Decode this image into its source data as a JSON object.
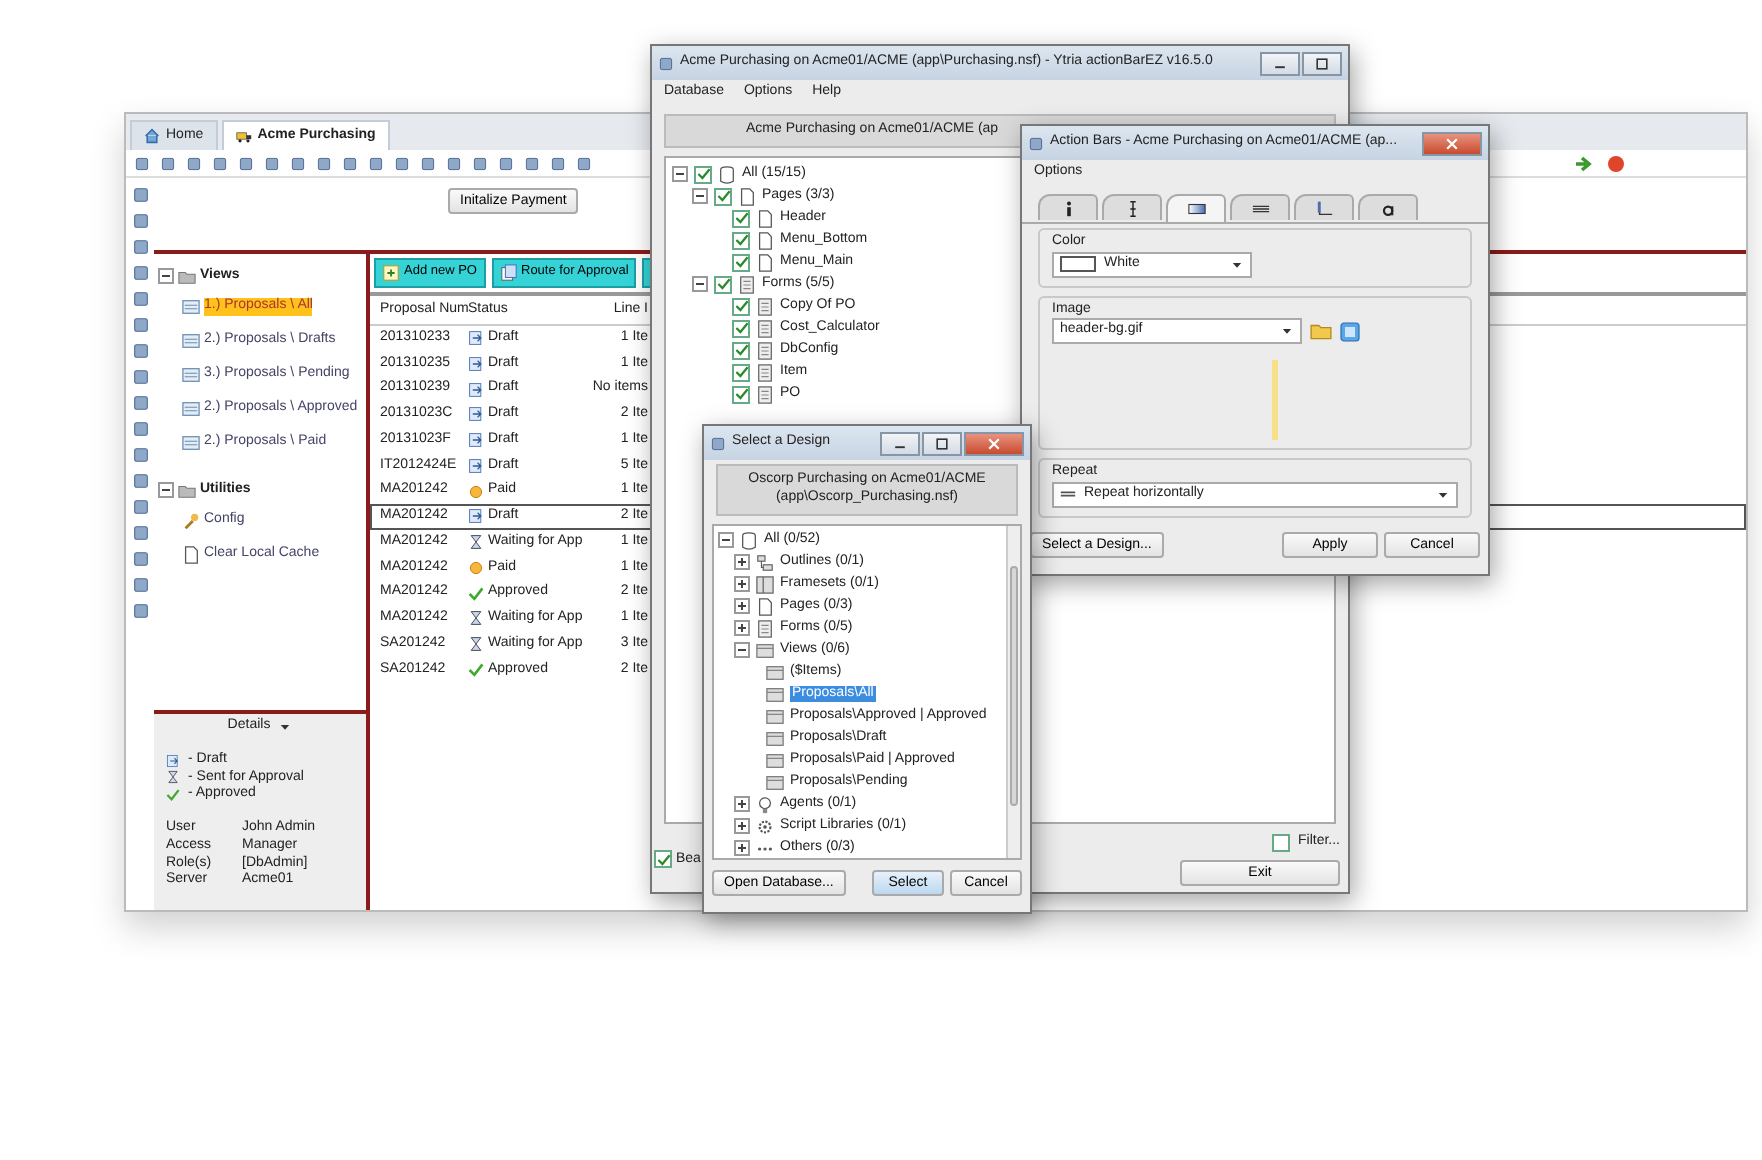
{
  "app": {
    "tabs": [
      {
        "label": "Home",
        "kind": "home",
        "selected": false
      },
      {
        "label": "Acme Purchasing",
        "kind": "truck",
        "selected": true
      }
    ],
    "initialize_button": "Initalize Payment",
    "nav": [
      {
        "label": "Views",
        "kind": "folder",
        "expanded": true,
        "children": [
          {
            "label": "1.) Proposals \\ All",
            "kind": "list",
            "selected": true
          },
          {
            "label": "2.) Proposals \\ Drafts",
            "kind": "list",
            "selected": false
          },
          {
            "label": "3.) Proposals \\ Pending",
            "kind": "list",
            "selected": false
          },
          {
            "label": "2.) Proposals \\ Approved",
            "kind": "list",
            "selected": false
          },
          {
            "label": "2.) Proposals \\ Paid",
            "kind": "list",
            "selected": false
          }
        ]
      },
      {
        "label": "Utilities",
        "kind": "folder",
        "expanded": true,
        "children": [
          {
            "label": "Config",
            "kind": "wrench",
            "selected": false
          },
          {
            "label": "Clear Local Cache",
            "kind": "page",
            "selected": false
          }
        ]
      }
    ],
    "details": {
      "title": "Details",
      "legend": [
        {
          "kind": "draft",
          "label": "- Draft"
        },
        {
          "kind": "waiting",
          "label": "- Sent for Approval"
        },
        {
          "kind": "approved",
          "label": "- Approved"
        }
      ],
      "info": [
        {
          "label": "User",
          "value": "John Admin"
        },
        {
          "label": "Access",
          "value": "Manager"
        },
        {
          "label": "Role(s)",
          "value": "[DbAdmin]"
        },
        {
          "label": "Server",
          "value": "Acme01"
        }
      ]
    },
    "actions": [
      "Add new PO",
      "Route for Approval"
    ],
    "table": {
      "columns": [
        "Proposal Num",
        "Status",
        "Line I"
      ],
      "rows": [
        {
          "number": "201310233",
          "status": "Draft",
          "kind": "draft",
          "items": "1 Ite",
          "selected": false
        },
        {
          "number": "201310235",
          "status": "Draft",
          "kind": "draft",
          "items": "1 Ite",
          "selected": false
        },
        {
          "number": "201310239",
          "status": "Draft",
          "kind": "draft",
          "items": "No items",
          "selected": false
        },
        {
          "number": "20131023C",
          "status": "Draft",
          "kind": "draft",
          "items": "2 Ite",
          "selected": false
        },
        {
          "number": "20131023F",
          "status": "Draft",
          "kind": "draft",
          "items": "1 Ite",
          "selected": false
        },
        {
          "number": "IT2012424E",
          "status": "Draft",
          "kind": "draft",
          "items": "5 Ite",
          "selected": false
        },
        {
          "number": "MA201242",
          "status": "Paid",
          "kind": "paid",
          "items": "1 Ite",
          "selected": false
        },
        {
          "number": "MA201242",
          "status": "Draft",
          "kind": "draft",
          "items": "2 Ite",
          "selected": true
        },
        {
          "number": "MA201242",
          "status": "Waiting for App",
          "kind": "waiting",
          "items": "1 Ite",
          "selected": false
        },
        {
          "number": "MA201242",
          "status": "Paid",
          "kind": "paid",
          "items": "1 Ite",
          "selected": false
        },
        {
          "number": "MA201242",
          "status": "Approved",
          "kind": "approved",
          "items": "2 Ite",
          "selected": false
        },
        {
          "number": "MA201242",
          "status": "Waiting for App",
          "kind": "waiting",
          "items": "1 Ite",
          "selected": false
        },
        {
          "number": "SA201242",
          "status": "Waiting for App",
          "kind": "waiting",
          "items": "3 Ite",
          "selected": false
        },
        {
          "number": "SA201242",
          "status": "Approved",
          "kind": "approved",
          "items": "2 Ite",
          "selected": false
        }
      ]
    }
  },
  "ytria_window": {
    "title": "Acme Purchasing on Acme01/ACME (app\\Purchasing.nsf) - Ytria actionBarEZ v16.5.0",
    "menu": [
      "Database",
      "Options",
      "Help"
    ],
    "header": "Acme Purchasing on Acme01/ACME (ap",
    "tree": [
      {
        "label": "All (15/15)",
        "kind": "db",
        "expanded": true,
        "checked": true,
        "children": [
          {
            "label": "Pages (3/3)",
            "kind": "page",
            "expanded": true,
            "checked": true,
            "children": [
              {
                "label": "Header",
                "kind": "page",
                "checked": true
              },
              {
                "label": "Menu_Bottom",
                "kind": "page",
                "checked": true
              },
              {
                "label": "Menu_Main",
                "kind": "page",
                "checked": true
              }
            ]
          },
          {
            "label": "Forms (5/5)",
            "kind": "form",
            "expanded": true,
            "checked": true,
            "children": [
              {
                "label": "Copy Of PO",
                "kind": "form",
                "checked": true
              },
              {
                "label": "Cost_Calculator",
                "kind": "form",
                "checked": true
              },
              {
                "label": "DbConfig",
                "kind": "form",
                "checked": true
              },
              {
                "label": "Item",
                "kind": "form",
                "checked": true
              },
              {
                "label": "PO",
                "kind": "form",
                "checked": true
              }
            ]
          }
        ]
      }
    ],
    "bottom_check": {
      "label": "Bea",
      "checked": true
    },
    "filter": {
      "label": "Filter...",
      "checked": false
    },
    "exit_button": "Exit"
  },
  "action_bars": {
    "title": "Action Bars - Acme Purchasing on Acme01/ACME (ap...",
    "menu": "Options",
    "tabs": [
      {
        "kind": "info",
        "selected": false
      },
      {
        "kind": "cursor",
        "selected": false
      },
      {
        "kind": "gradient",
        "selected": true
      },
      {
        "kind": "lines",
        "selected": false
      },
      {
        "kind": "corner",
        "selected": false
      },
      {
        "kind": "font",
        "selected": false
      }
    ],
    "color_label": "Color",
    "color_value": "White",
    "image_label": "Image",
    "image_value": "header-bg.gif",
    "repeat_label": "Repeat",
    "repeat_value": "Repeat horizontally",
    "buttons": [
      "Select a Design...",
      "Apply",
      "Cancel"
    ]
  },
  "select_dialog": {
    "title": "Select a Design",
    "header_lines": [
      "Oscorp Purchasing on Acme01/ACME",
      "(app\\Oscorp_Purchasing.nsf)"
    ],
    "tree": [
      {
        "label": "All (0/52)",
        "kind": "db",
        "expanded": true,
        "selected": false,
        "children": [
          {
            "label": "Outlines (0/1)",
            "kind": "outline",
            "expanded": false,
            "selected": false
          },
          {
            "label": "Framesets (0/1)",
            "kind": "frameset",
            "expanded": false,
            "selected": false
          },
          {
            "label": "Pages (0/3)",
            "kind": "page",
            "expanded": false,
            "selected": false
          },
          {
            "label": "Forms (0/5)",
            "kind": "form",
            "expanded": false,
            "selected": false
          },
          {
            "label": "Views (0/6)",
            "kind": "view",
            "expanded": true,
            "selected": false,
            "children": [
              {
                "label": "($Items)",
                "kind": "view",
                "selected": false
              },
              {
                "label": "Proposals\\All",
                "kind": "view",
                "selected": true
              },
              {
                "label": "Proposals\\Approved | Approved",
                "kind": "view",
                "selected": false
              },
              {
                "label": "Proposals\\Draft",
                "kind": "view",
                "selected": false
              },
              {
                "label": "Proposals\\Paid | Approved",
                "kind": "view",
                "selected": false
              },
              {
                "label": "Proposals\\Pending",
                "kind": "view",
                "selected": false
              }
            ]
          },
          {
            "label": "Agents (0/1)",
            "kind": "agent",
            "expanded": false,
            "selected": false
          },
          {
            "label": "Script Libraries (0/1)",
            "kind": "script",
            "expanded": false,
            "selected": false
          },
          {
            "label": "Others (0/3)",
            "kind": "other",
            "expanded": false,
            "selected": false
          }
        ]
      }
    ],
    "buttons": [
      "Open Database...",
      "Select",
      "Cancel"
    ]
  }
}
